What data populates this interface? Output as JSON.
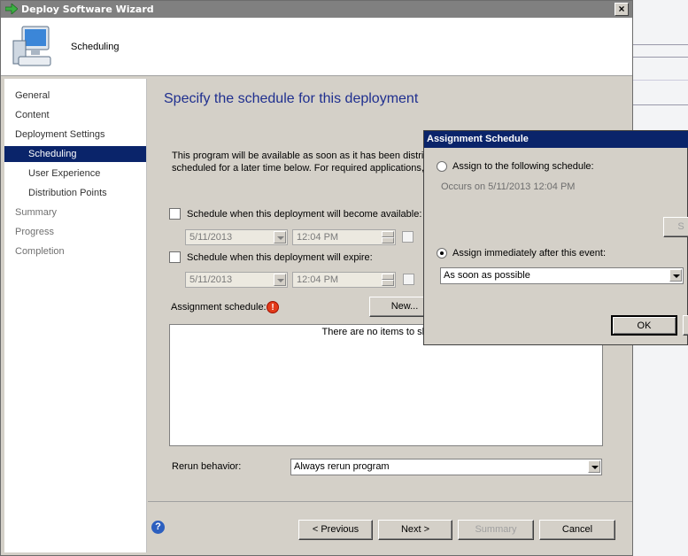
{
  "window": {
    "title": "Deploy Software Wizard",
    "page_header": "Scheduling"
  },
  "nav": {
    "items": [
      {
        "label": "General",
        "state": "normal"
      },
      {
        "label": "Content",
        "state": "normal"
      },
      {
        "label": "Deployment Settings",
        "state": "normal"
      },
      {
        "label": "Scheduling",
        "state": "active"
      },
      {
        "label": "User Experience",
        "state": "normal"
      },
      {
        "label": "Distribution Points",
        "state": "normal"
      },
      {
        "label": "Summary",
        "state": "dim"
      },
      {
        "label": "Progress",
        "state": "dim"
      },
      {
        "label": "Completion",
        "state": "dim"
      }
    ]
  },
  "main": {
    "heading": "Specify the schedule for this deployment",
    "description_line1": "This program will be available as soon as it has been distribu",
    "description_line2": "scheduled for a later time below. For required applications, sp",
    "available": {
      "label": "Schedule when this deployment will become available:",
      "date": "5/11/2013",
      "time": "12:04 PM",
      "checked": false
    },
    "expire": {
      "label": "Schedule when this deployment will expire:",
      "date": "5/11/2013",
      "time": "12:04 PM",
      "checked": false
    },
    "assignment_label": "Assignment schedule:",
    "new_button": "New...",
    "empty_list": "There are no items to show in",
    "rerun_label": "Rerun behavior:",
    "rerun_value": "Always rerun program"
  },
  "footer": {
    "previous": "< Previous",
    "next": "Next >",
    "summary": "Summary",
    "cancel": "Cancel"
  },
  "dialog": {
    "title": "Assignment Schedule",
    "option_schedule": "Assign to the following schedule:",
    "occurs": "Occurs on 5/11/2013 12:04 PM",
    "schedule_button": "S",
    "option_event": "Assign immediately after this event:",
    "event_value": "As soon as possible",
    "ok": "OK"
  },
  "colors": {
    "title_inactive": "#808080",
    "title_active": "#0a246a",
    "heading": "#1f2f8f",
    "selection": "#0a246a"
  }
}
